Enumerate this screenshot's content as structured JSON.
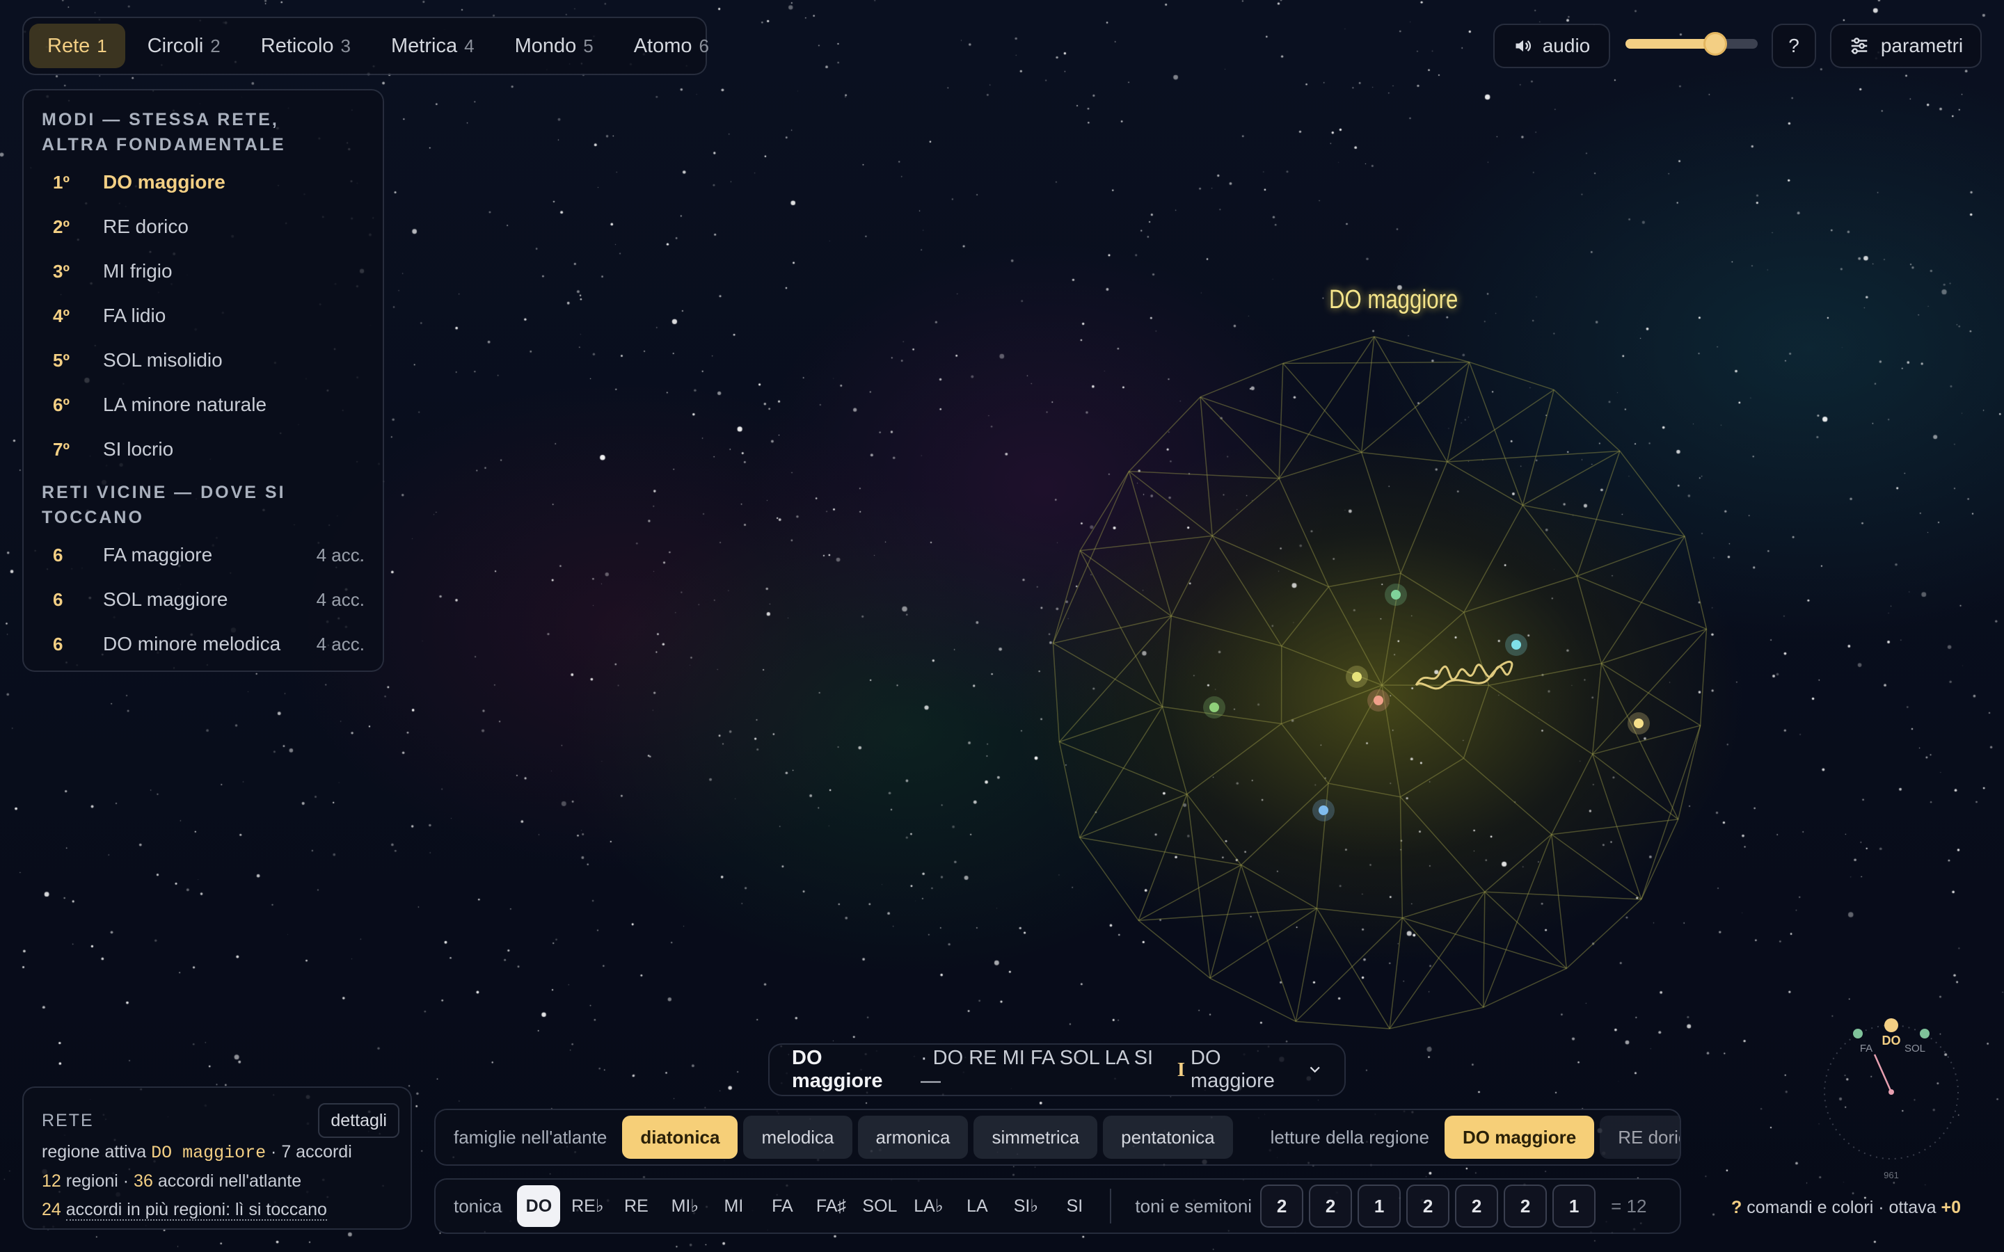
{
  "tabs": [
    {
      "label": "Rete",
      "key": "1"
    },
    {
      "label": "Circoli",
      "key": "2"
    },
    {
      "label": "Reticolo",
      "key": "3"
    },
    {
      "label": "Metrica",
      "key": "4"
    },
    {
      "label": "Mondo",
      "key": "5"
    },
    {
      "label": "Atomo",
      "key": "6"
    }
  ],
  "modes_panel": {
    "title": "MODI — STESSA RETE, ALTRA FONDAMENTALE",
    "modes": [
      {
        "degree": "1º",
        "name": "DO maggiore"
      },
      {
        "degree": "2º",
        "name": "RE dorico"
      },
      {
        "degree": "3º",
        "name": "MI frigio"
      },
      {
        "degree": "4º",
        "name": "FA lidio"
      },
      {
        "degree": "5º",
        "name": "SOL misolidio"
      },
      {
        "degree": "6º",
        "name": "LA minore naturale"
      },
      {
        "degree": "7º",
        "name": "SI locrio"
      }
    ],
    "neighbors_title": "RETI VICINE — DOVE SI TOCCANO",
    "neighbors": [
      {
        "shared": "6",
        "name": "FA maggiore",
        "count": "4 acc."
      },
      {
        "shared": "6",
        "name": "SOL maggiore",
        "count": "4 acc."
      },
      {
        "shared": "6",
        "name": "DO minore melodica",
        "count": "4 acc."
      }
    ]
  },
  "top_controls": {
    "audio_label": "audio",
    "volume": 0.68,
    "help_label": "?",
    "params_label": "parametri"
  },
  "globe": {
    "label": "DO maggiore"
  },
  "rete_card": {
    "title": "RETE",
    "details_label": "dettagli",
    "line1_prefix": "regione attiva",
    "active_region": "DO maggiore",
    "line1_suffix": "· 7 accordi",
    "regions_count": "12",
    "regions_text": "regioni ·",
    "chords_count": "36",
    "chords_text": "accordi nell'atlante",
    "shared_count": "24",
    "shared_text": "accordi in più regioni: lì si toccano"
  },
  "summary": {
    "name": "DO maggiore",
    "notes": "· DO RE MI FA SOL LA SI —",
    "roman": "I",
    "region": "DO maggiore"
  },
  "families": {
    "label": "famiglie nell'atlante",
    "items": [
      "diatonica",
      "melodica",
      "armonica",
      "simmetrica",
      "pentatonica"
    ],
    "selected": "diatonica",
    "readings_label": "letture della regione",
    "readings": [
      "DO maggiore",
      "RE dorico"
    ],
    "reading_selected": "DO maggiore"
  },
  "tonica": {
    "label": "tonica",
    "notes": [
      "DO",
      "RE♭",
      "RE",
      "MI♭",
      "MI",
      "FA",
      "FA♯",
      "SOL",
      "LA♭",
      "LA",
      "SI♭",
      "SI"
    ],
    "selected": "DO",
    "steps_label": "toni e semitoni",
    "steps": [
      "2",
      "2",
      "1",
      "2",
      "2",
      "2",
      "1"
    ],
    "total": "= 12"
  },
  "compass": {
    "center": "DO",
    "left": "FA",
    "right": "SOL",
    "bottom": "961"
  },
  "hint": {
    "q": "?",
    "text": "comandi e colori · ottava",
    "octave": "+0"
  }
}
